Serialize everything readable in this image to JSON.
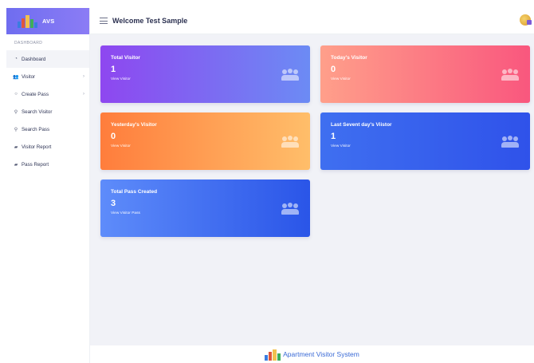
{
  "brand": {
    "name": "AVS"
  },
  "sidebar": {
    "section": "DASHBOARD",
    "items": [
      {
        "label": "Dashboard",
        "icon": "dashboard-icon",
        "active": true,
        "chevron": ""
      },
      {
        "label": "Visitor",
        "icon": "users-icon",
        "active": false,
        "chevron": "›"
      },
      {
        "label": "Create Pass",
        "icon": "lightbulb-icon",
        "active": false,
        "chevron": "›"
      },
      {
        "label": "Search Visitor",
        "icon": "search-icon",
        "active": false,
        "chevron": ""
      },
      {
        "label": "Search Pass",
        "icon": "search-icon",
        "active": false,
        "chevron": ""
      },
      {
        "label": "Visitor Report",
        "icon": "folder-icon",
        "active": false,
        "chevron": ""
      },
      {
        "label": "Pass Report",
        "icon": "folder-icon",
        "active": false,
        "chevron": ""
      }
    ]
  },
  "header": {
    "title": "Welcome Test Sample"
  },
  "cards": [
    {
      "title": "Total Visitor",
      "value": "1",
      "link": "View Visitor"
    },
    {
      "title": "Today's Visitor",
      "value": "0",
      "link": "View Visitor"
    },
    {
      "title": "Yesterday's Visitor",
      "value": "0",
      "link": "View Visitor"
    },
    {
      "title": "Last Sevent day's Viistor",
      "value": "1",
      "link": "View Visitor"
    },
    {
      "title": "Total Pass Created",
      "value": "3",
      "link": "View Visitor Pass"
    }
  ],
  "footer": {
    "text": "Apartment Visitor System"
  },
  "colors": {
    "brand": "#7a73f3",
    "link": "#3a6ad6"
  }
}
